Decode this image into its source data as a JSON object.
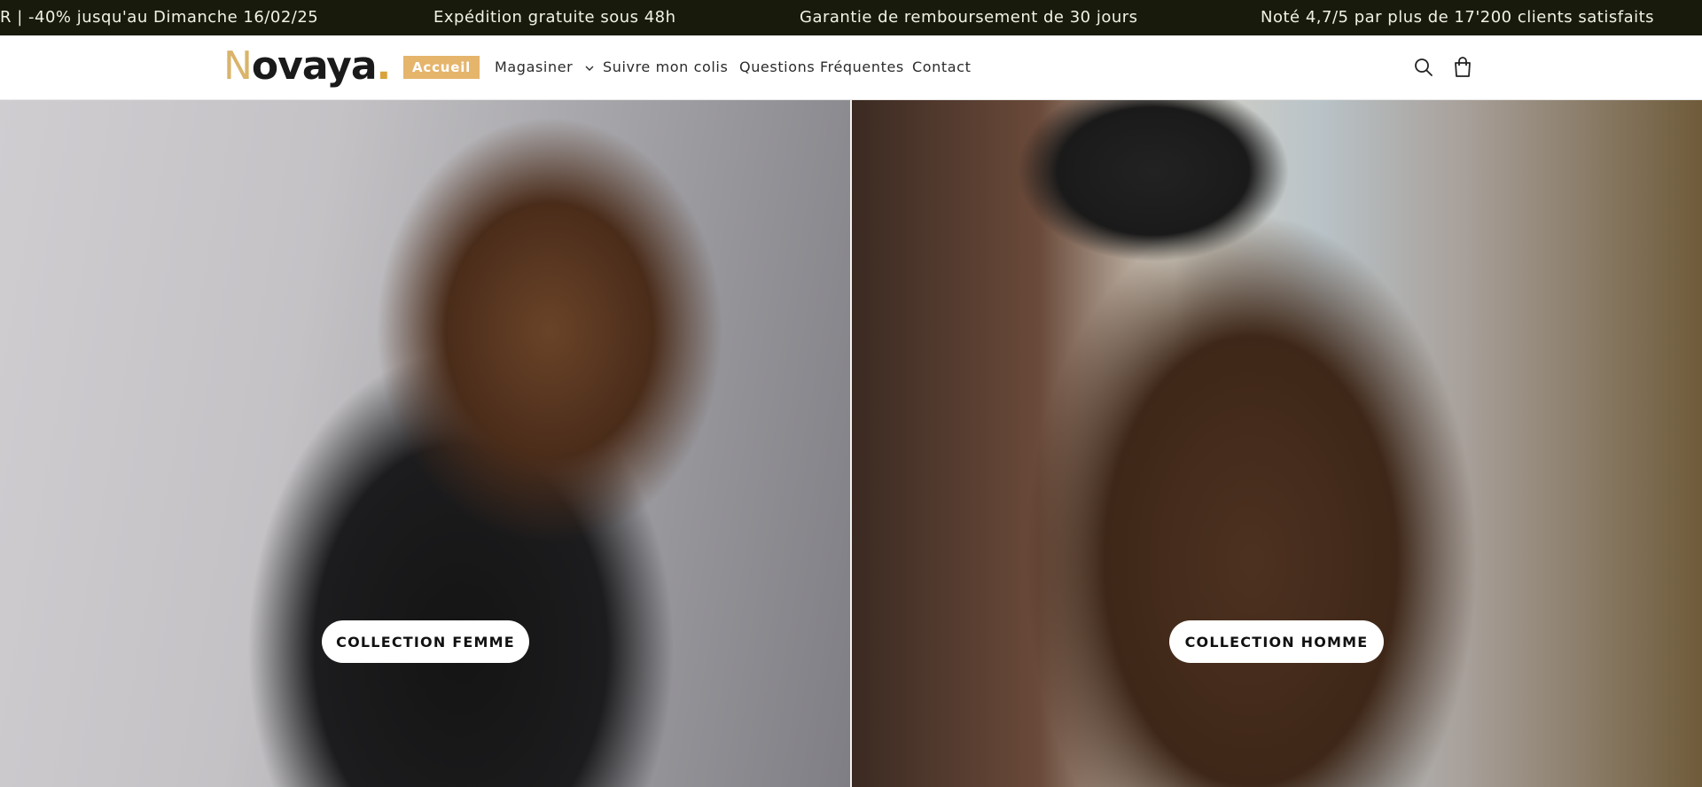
{
  "announcement": {
    "messages": [
      "R | -40% jusqu'au Dimanche 16/02/25",
      "Expédition gratuite sous 48h",
      "Garantie de remboursement de 30 jours",
      "Noté 4,7/5 par plus de 17'200 clients satisfaits"
    ]
  },
  "header": {
    "logo": {
      "first": "N",
      "rest": "ovaya",
      "dot": "."
    },
    "nav": {
      "active": "Accueil",
      "items": [
        "Magasiner",
        "Suivre mon colis",
        "Questions Fréquentes",
        "Contact"
      ]
    },
    "icons": {
      "search": "search-icon",
      "cart": "shopping-bag-icon",
      "dropdown": "chevron-down-icon"
    }
  },
  "hero": {
    "left_button": "COLLECTION FEMME",
    "right_button": "COLLECTION HOMME"
  },
  "colors": {
    "announcement_bg": "#181b0c",
    "accent": "#e5b56c"
  }
}
